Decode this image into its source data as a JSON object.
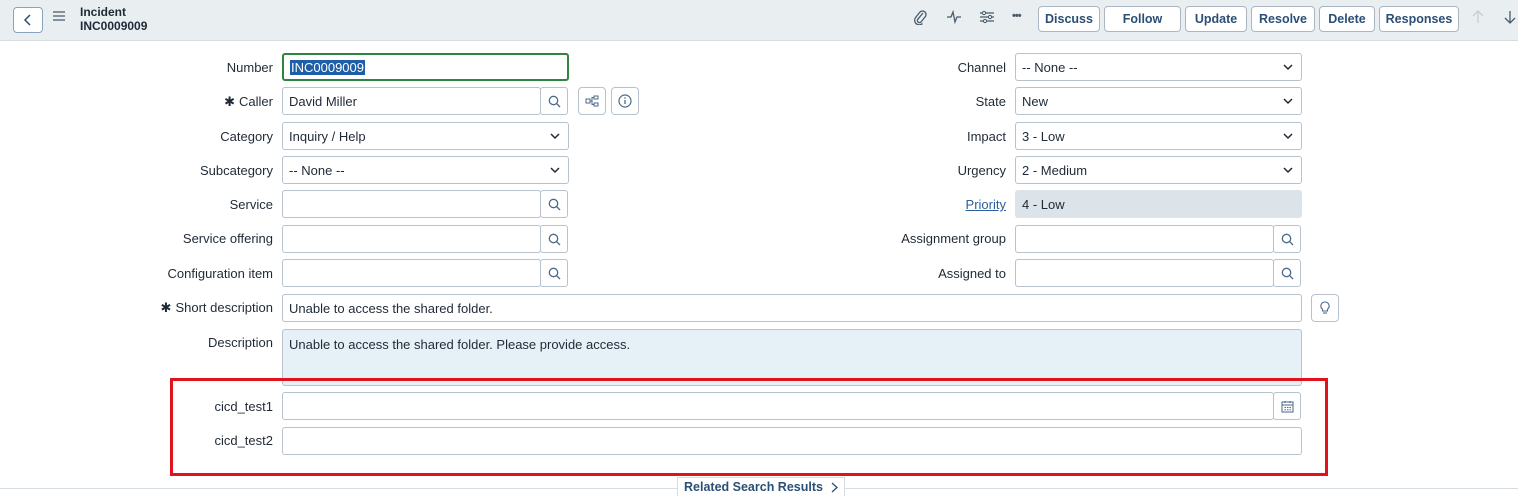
{
  "header": {
    "record_type": "Incident",
    "record_number": "INC0009009",
    "buttons": [
      "Discuss",
      "Follow",
      "Update",
      "Resolve",
      "Delete",
      "Responses"
    ],
    "more_label": "•••"
  },
  "form": {
    "left": {
      "number": {
        "label": "Number",
        "value": "INC0009009"
      },
      "caller": {
        "label": "Caller",
        "value": "David Miller"
      },
      "category": {
        "label": "Category",
        "value": "Inquiry / Help"
      },
      "subcategory": {
        "label": "Subcategory",
        "value": "-- None --"
      },
      "service": {
        "label": "Service",
        "value": ""
      },
      "service_offering": {
        "label": "Service offering",
        "value": ""
      },
      "configuration_item": {
        "label": "Configuration item",
        "value": ""
      }
    },
    "right": {
      "channel": {
        "label": "Channel",
        "value": "-- None --"
      },
      "state": {
        "label": "State",
        "value": "New"
      },
      "impact": {
        "label": "Impact",
        "value": "3 - Low"
      },
      "urgency": {
        "label": "Urgency",
        "value": "2 - Medium"
      },
      "priority": {
        "label": "Priority",
        "value": "4 - Low"
      },
      "assignment_group": {
        "label": "Assignment group",
        "value": ""
      },
      "assigned_to": {
        "label": "Assigned to",
        "value": ""
      }
    },
    "short_description": {
      "label": "Short description",
      "value": "Unable to access the shared folder."
    },
    "description": {
      "label": "Description",
      "value": "Unable to access the shared folder. Please provide access."
    },
    "cicd_test1": {
      "label": "cicd_test1",
      "value": ""
    },
    "cicd_test2": {
      "label": "cicd_test2",
      "value": ""
    }
  },
  "footer": {
    "related_label": "Related Search Results"
  },
  "colors": {
    "highlight_box": "#e0121b",
    "header_bg": "#e9eef1",
    "number_border": "#2e8540"
  }
}
